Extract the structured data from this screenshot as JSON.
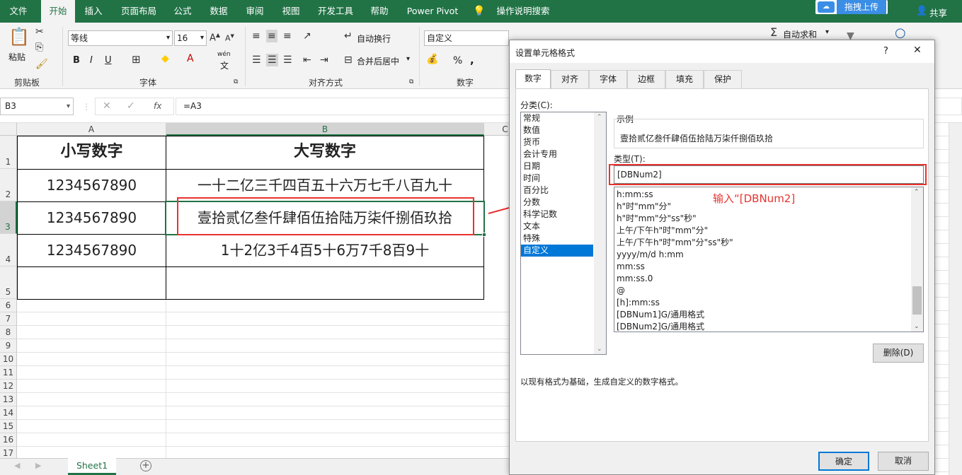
{
  "ribbon_tabs": [
    "文件",
    "开始",
    "插入",
    "页面布局",
    "公式",
    "数据",
    "审阅",
    "视图",
    "开发工具",
    "帮助",
    "Power Pivot",
    "操作说明搜索"
  ],
  "active_tab": "开始",
  "upload_label": "拖拽上传",
  "share_label": "共享",
  "ribbon": {
    "paste": "粘贴",
    "clipboard": "剪贴板",
    "font_name": "等线",
    "font_size": "16",
    "font_group": "字体",
    "bold": "B",
    "italic": "I",
    "underline": "U",
    "wen": "wén",
    "wen_char": "文",
    "wrap_text": "自动换行",
    "merge_center": "合并后居中",
    "align_group": "对齐方式",
    "number_format": "自定义",
    "number_group": "数字",
    "autosum": "自动求和",
    "percent": "%",
    "comma": ","
  },
  "formula_bar": {
    "name_box": "B3",
    "fx": "fx",
    "formula": "=A3"
  },
  "columns": [
    "A",
    "B",
    "C"
  ],
  "rows": [
    "1",
    "2",
    "3",
    "4",
    "5",
    "6",
    "7",
    "8",
    "9",
    "10",
    "11",
    "12",
    "13",
    "14",
    "15",
    "16",
    "17"
  ],
  "table": [
    [
      "小写数字",
      "大写数字"
    ],
    [
      "1234567890",
      "一十二亿三千四百五十六万七千八百九十"
    ],
    [
      "1234567890",
      "壹拾贰亿叁仟肆佰伍拾陆万柒仟捌佰玖拾"
    ],
    [
      "1234567890",
      "1十2亿3千4百5十6万7千8百9十"
    ],
    [
      "",
      ""
    ]
  ],
  "sheet_tab": "Sheet1",
  "dialog": {
    "title": "设置单元格格式",
    "help": "?",
    "close": "✕",
    "tabs": [
      "数字",
      "对齐",
      "字体",
      "边框",
      "填充",
      "保护"
    ],
    "category_label": "分类(C):",
    "categories": [
      "常规",
      "数值",
      "货币",
      "会计专用",
      "日期",
      "时间",
      "百分比",
      "分数",
      "科学记数",
      "文本",
      "特殊",
      "自定义"
    ],
    "selected_category": "自定义",
    "sample_label": "示例",
    "sample_value": "壹拾贰亿叁仟肆佰伍拾陆万柒仟捌佰玖拾",
    "type_label": "类型(T):",
    "type_value": "[DBNum2]",
    "formats": [
      "h:mm:ss",
      "h\"时\"mm\"分\"",
      "h\"时\"mm\"分\"ss\"秒\"",
      "上午/下午h\"时\"mm\"分\"",
      "上午/下午h\"时\"mm\"分\"ss\"秒\"",
      "yyyy/m/d h:mm",
      "mm:ss",
      "mm:ss.0",
      "@",
      "[h]:mm:ss",
      "[DBNum1]G/通用格式",
      "[DBNum2]G/通用格式"
    ],
    "delete_btn": "删除(D)",
    "description": "以现有格式为基础，生成自定义的数字格式。",
    "ok": "确定",
    "cancel": "取消"
  },
  "annotation": "输入“[DBNum2]",
  "colors": {
    "excel_green": "#217346",
    "highlight_red": "#e8332f",
    "selection_blue": "#0078d7"
  }
}
